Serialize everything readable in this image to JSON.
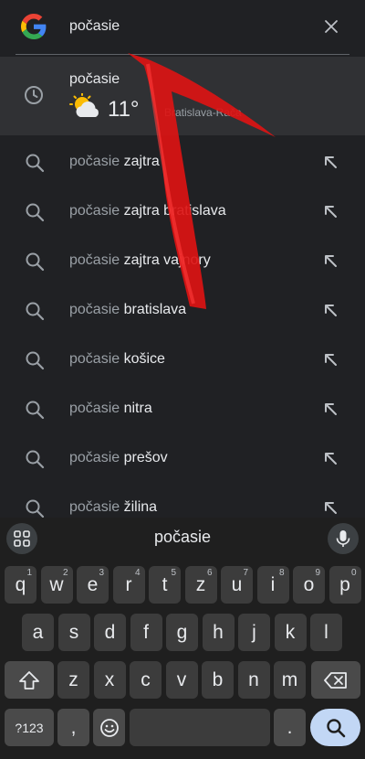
{
  "search": {
    "query": "počasie",
    "clear_icon": "close-icon"
  },
  "history": {
    "title": "počasie",
    "temperature": "11°",
    "location": "Bratislava-Rača",
    "icon": "partly-cloudy-icon"
  },
  "suggestions": [
    {
      "prefix": "počasie ",
      "rest": "zajtra"
    },
    {
      "prefix": "počasie ",
      "rest": "zajtra bratislava"
    },
    {
      "prefix": "počasie ",
      "rest": "zajtra vajnory"
    },
    {
      "prefix": "počasie ",
      "rest": "bratislava"
    },
    {
      "prefix": "počasie ",
      "rest": "košice"
    },
    {
      "prefix": "počasie ",
      "rest": "nitra"
    },
    {
      "prefix": "počasie ",
      "rest": "prešov"
    },
    {
      "prefix": "počasie ",
      "rest": "žilina"
    }
  ],
  "keyboard": {
    "suggestion": "počasie",
    "row1": [
      {
        "k": "q",
        "h": "1"
      },
      {
        "k": "w",
        "h": "2"
      },
      {
        "k": "e",
        "h": "3"
      },
      {
        "k": "r",
        "h": "4"
      },
      {
        "k": "t",
        "h": "5"
      },
      {
        "k": "z",
        "h": "6"
      },
      {
        "k": "u",
        "h": "7"
      },
      {
        "k": "i",
        "h": "8"
      },
      {
        "k": "o",
        "h": "9"
      },
      {
        "k": "p",
        "h": "0"
      }
    ],
    "row2": [
      "a",
      "s",
      "d",
      "f",
      "g",
      "h",
      "j",
      "k",
      "l"
    ],
    "row3": [
      "z",
      "x",
      "c",
      "v",
      "b",
      "n",
      "m"
    ],
    "symbols_label": "?123",
    "comma": ",",
    "period": "."
  },
  "colors": {
    "background": "#202124",
    "annotation": "#e01010"
  }
}
